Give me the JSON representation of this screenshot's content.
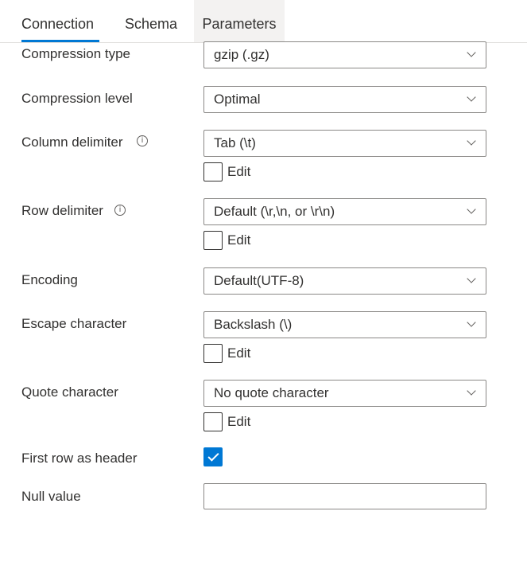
{
  "tabs": [
    {
      "label": "Connection"
    },
    {
      "label": "Schema"
    },
    {
      "label": "Parameters"
    }
  ],
  "colors": {
    "accent": "#0078d4",
    "border": "#8a8886",
    "text": "#323130"
  },
  "fields": {
    "compression_type": {
      "label": "Compression type",
      "value": "gzip (.gz)"
    },
    "compression_level": {
      "label": "Compression level",
      "value": "Optimal"
    },
    "column_delimiter": {
      "label": "Column delimiter",
      "value": "Tab (\\t)",
      "edit_label": "Edit",
      "edit_checked": false
    },
    "row_delimiter": {
      "label": "Row delimiter",
      "value": "Default (\\r,\\n, or \\r\\n)",
      "edit_label": "Edit",
      "edit_checked": false
    },
    "encoding": {
      "label": "Encoding",
      "value": "Default(UTF-8)"
    },
    "escape_character": {
      "label": "Escape character",
      "value": "Backslash (\\)",
      "edit_label": "Edit",
      "edit_checked": false
    },
    "quote_character": {
      "label": "Quote character",
      "value": "No quote character",
      "edit_label": "Edit",
      "edit_checked": false
    },
    "first_row_header": {
      "label": "First row as header",
      "checked": true
    },
    "null_value": {
      "label": "Null value",
      "value": ""
    }
  },
  "icons": {
    "info": "info-icon",
    "dropdown": "chevron-down-icon",
    "check": "checkmark-icon"
  }
}
